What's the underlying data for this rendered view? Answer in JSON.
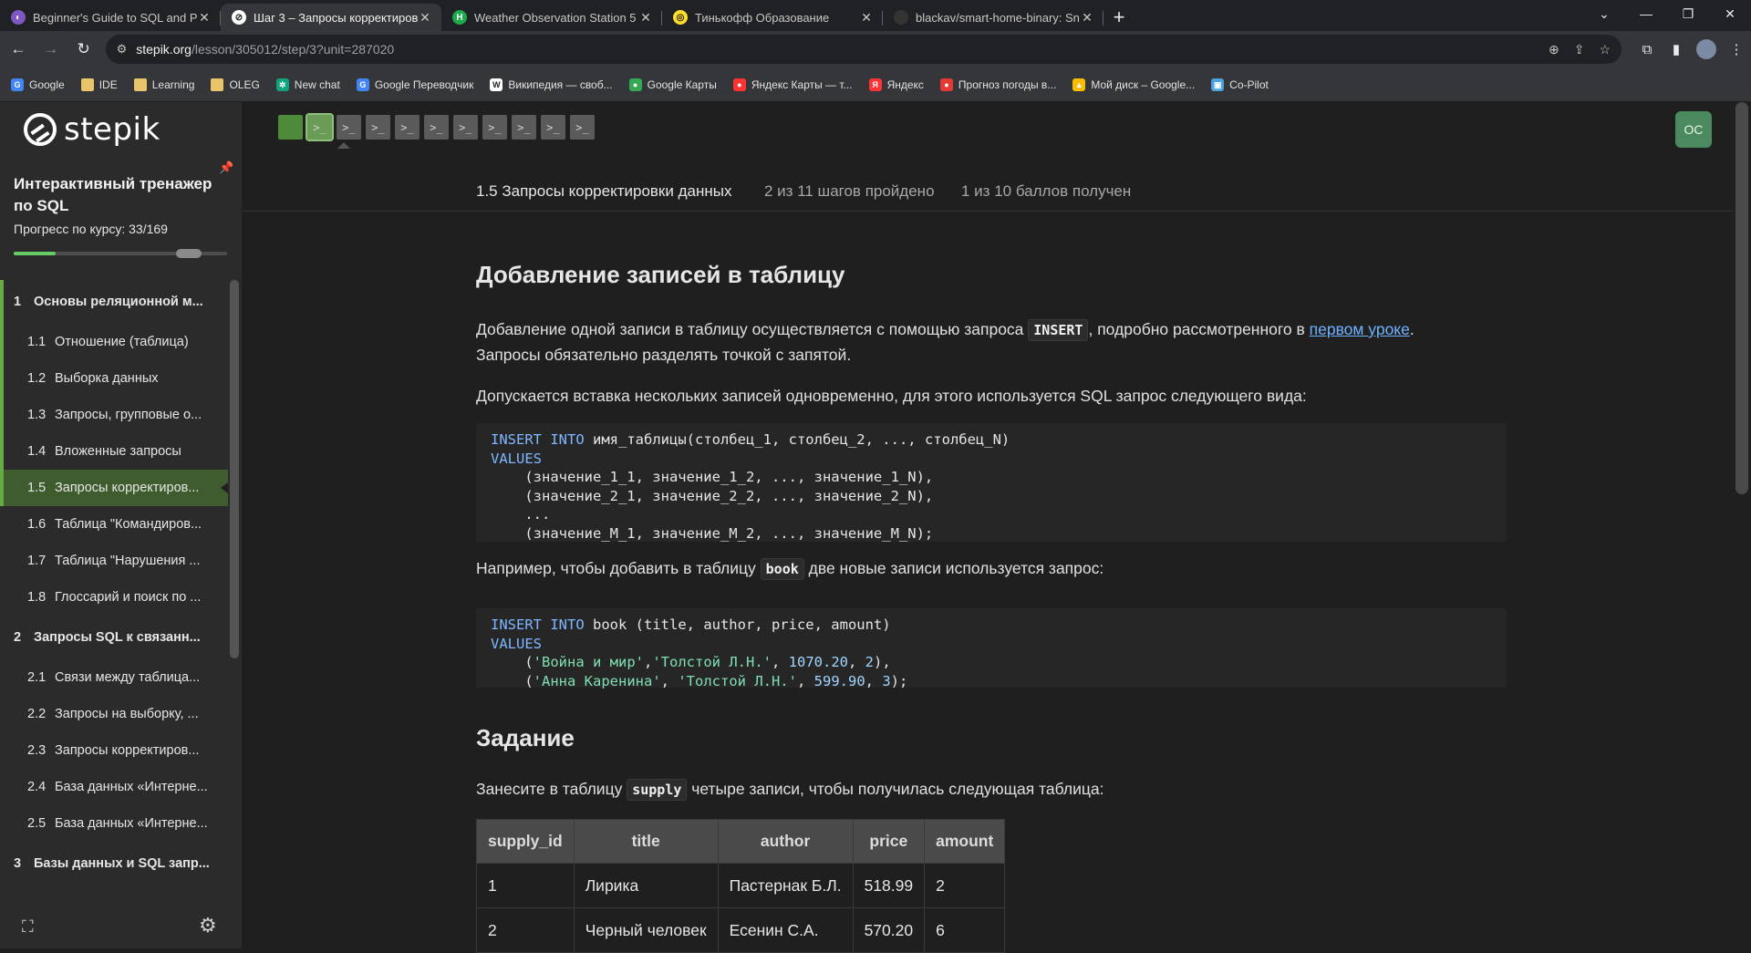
{
  "browser": {
    "tabs": [
      {
        "title": "Beginner's Guide to SQL and Pe",
        "favicon_color": "#7e57c2",
        "favicon_glyph": "◐",
        "active": false
      },
      {
        "title": "Шаг 3 – Запросы корректиров",
        "favicon_color": "#ffffff",
        "favicon_glyph": "⊘",
        "active": true
      },
      {
        "title": "Weather Observation Station 5",
        "favicon_color": "#1ba94c",
        "favicon_glyph": "H",
        "active": false
      },
      {
        "title": "Тинькофф Образование",
        "favicon_color": "#ffdd2d",
        "favicon_glyph": "◎",
        "active": false
      },
      {
        "title": "blackav/smart-home-binary: Sn",
        "favicon_color": "#333333",
        "favicon_glyph": "",
        "active": false
      }
    ],
    "new_tab_label": "+",
    "address": {
      "host": "stepik.org",
      "path": "/lesson/305012/step/3?unit=287020"
    },
    "bookmarks": [
      {
        "label": "Google",
        "type": "site",
        "color": "#4285f4",
        "glyph": "G"
      },
      {
        "label": "IDE",
        "type": "folder"
      },
      {
        "label": "Learning",
        "type": "folder"
      },
      {
        "label": "OLEG",
        "type": "folder"
      },
      {
        "label": "New chat",
        "type": "site",
        "color": "#10a37f",
        "glyph": "✲"
      },
      {
        "label": "Google Переводчик",
        "type": "site",
        "color": "#4285f4",
        "glyph": "G"
      },
      {
        "label": "Википедия — своб...",
        "type": "site",
        "color": "#ffffff",
        "glyph": "W"
      },
      {
        "label": "Google Карты",
        "type": "site",
        "color": "#34a853",
        "glyph": "●"
      },
      {
        "label": "Яндекс Карты — т...",
        "type": "site",
        "color": "#ff3333",
        "glyph": "●"
      },
      {
        "label": "Яндекс",
        "type": "site",
        "color": "#ff3333",
        "glyph": "Я"
      },
      {
        "label": "Прогноз погоды в...",
        "type": "site",
        "color": "#e53935",
        "glyph": "●"
      },
      {
        "label": "Мой диск – Google...",
        "type": "site",
        "color": "#fbbc04",
        "glyph": "▲"
      },
      {
        "label": "Co-Pilot",
        "type": "site",
        "color": "#4aa3df",
        "glyph": "▣"
      }
    ]
  },
  "sidebar": {
    "logo_text": "stepik",
    "course_title": "Интерактивный тренажер по SQL",
    "progress_label": "Прогресс по курсу:  33/169",
    "progress_fraction": 0.195,
    "toc": [
      {
        "num": "1",
        "label": "Основы реляционной м...",
        "section": true,
        "done": true,
        "active": false
      },
      {
        "num": "1.1",
        "label": "Отношение (таблица)",
        "section": false,
        "done": true,
        "active": false
      },
      {
        "num": "1.2",
        "label": "Выборка данных",
        "section": false,
        "done": true,
        "active": false
      },
      {
        "num": "1.3",
        "label": "Запросы, групповые о...",
        "section": false,
        "done": true,
        "active": false
      },
      {
        "num": "1.4",
        "label": "Вложенные запросы",
        "section": false,
        "done": true,
        "active": false
      },
      {
        "num": "1.5",
        "label": "Запросы корректиров...",
        "section": false,
        "done": true,
        "active": true
      },
      {
        "num": "1.6",
        "label": "Таблица \"Командиров...",
        "section": false,
        "done": false,
        "active": false
      },
      {
        "num": "1.7",
        "label": "Таблица \"Нарушения ...",
        "section": false,
        "done": false,
        "active": false
      },
      {
        "num": "1.8",
        "label": "Глоссарий и поиск по ...",
        "section": false,
        "done": false,
        "active": false
      },
      {
        "num": "2",
        "label": "Запросы SQL к связанн...",
        "section": true,
        "done": false,
        "active": false
      },
      {
        "num": "2.1",
        "label": "Связи между таблица...",
        "section": false,
        "done": false,
        "active": false
      },
      {
        "num": "2.2",
        "label": "Запросы на выборку, ...",
        "section": false,
        "done": false,
        "active": false
      },
      {
        "num": "2.3",
        "label": "Запросы корректиров...",
        "section": false,
        "done": false,
        "active": false
      },
      {
        "num": "2.4",
        "label": "База данных «Интерне...",
        "section": false,
        "done": false,
        "active": false
      },
      {
        "num": "2.5",
        "label": "База данных «Интерне...",
        "section": false,
        "done": false,
        "active": false
      },
      {
        "num": "3",
        "label": "Базы данных и SQL запр...",
        "section": true,
        "done": false,
        "active": false
      }
    ]
  },
  "main": {
    "steps": [
      {
        "state": "done",
        "glyph": ""
      },
      {
        "state": "current",
        "glyph": ">_"
      },
      {
        "state": "todo",
        "glyph": ">_"
      },
      {
        "state": "todo",
        "glyph": ">_"
      },
      {
        "state": "todo",
        "glyph": ">_"
      },
      {
        "state": "todo",
        "glyph": ">_"
      },
      {
        "state": "todo",
        "glyph": ">_"
      },
      {
        "state": "todo",
        "glyph": ">_"
      },
      {
        "state": "todo",
        "glyph": ">_"
      },
      {
        "state": "todo",
        "glyph": ">_"
      },
      {
        "state": "todo",
        "glyph": ">_"
      }
    ],
    "user_initials": "OC",
    "lesson_title": "1.5 Запросы корректировки данных",
    "steps_status": "2 из 11 шагов пройдено",
    "points_status": "1 из 10 баллов  получен",
    "heading": "Добавление записей в таблицу",
    "p1_before": "Добавление одной записи в таблицу осуществляется с помощью запроса ",
    "p1_code": "INSERT",
    "p1_mid": ", подробно рассмотренного в ",
    "p1_link": "первом уроке",
    "p1_after": ".",
    "p1_line2": "Запросы обязательно разделять точкой с запятой.",
    "p2": "Допускается вставка нескольких записей одновременно, для этого используется SQL запрос следующего вида:",
    "p3_before": "Например, чтобы добавить в таблицу ",
    "p3_code": "book",
    "p3_after": " две новые записи используется запрос:",
    "task_heading": "Задание",
    "p4_before": "Занесите в таблицу ",
    "p4_code": "supply",
    "p4_after": " четыре записи, чтобы получилась следующая таблица:",
    "table": {
      "headers": [
        "supply_id",
        "title",
        "author",
        "price",
        "amount"
      ],
      "rows": [
        [
          "1",
          "Лирика",
          "Пастернак Б.Л.",
          "518.99",
          "2"
        ],
        [
          "2",
          "Черный человек",
          "Есенин С.А.",
          "570.20",
          "6"
        ]
      ]
    }
  }
}
